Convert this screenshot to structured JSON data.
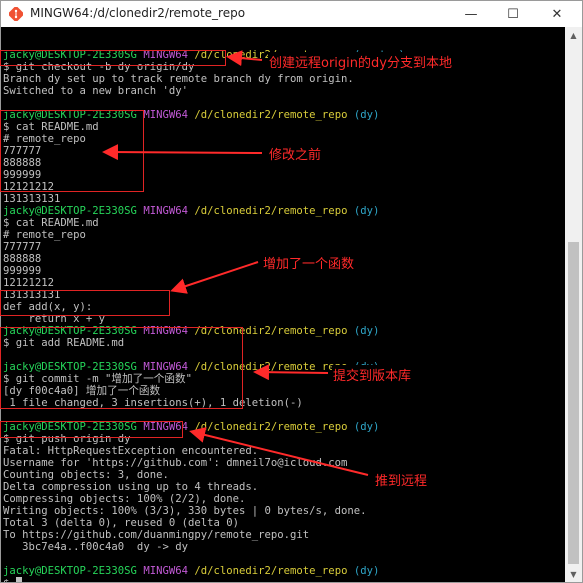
{
  "window": {
    "title": "MINGW64:/d/clonedir2/remote_repo",
    "minimize": "—",
    "maximize": "☐",
    "close": "✕"
  },
  "terminal": {
    "lines": [
      {
        "segments": []
      },
      {
        "segments": [
          {
            "t": "jacky@DESKTOP-2E330SG",
            "c": "user"
          },
          {
            "t": " "
          },
          {
            "t": "MINGW64",
            "c": "host"
          },
          {
            "t": " "
          },
          {
            "t": "/d/clonedir2/remote_repo",
            "c": "path"
          },
          {
            "t": " "
          },
          {
            "t": "(master)",
            "c": "branch"
          }
        ]
      },
      {
        "segments": [
          {
            "t": "$ git checkout -b dy origin/dy"
          }
        ]
      },
      {
        "segments": [
          {
            "t": "Branch dy set up to track remote branch dy from origin."
          }
        ]
      },
      {
        "segments": [
          {
            "t": "Switched to a new branch 'dy'"
          }
        ]
      },
      {
        "segments": []
      },
      {
        "segments": [
          {
            "t": "jacky@DESKTOP-2E330SG",
            "c": "user"
          },
          {
            "t": " "
          },
          {
            "t": "MINGW64",
            "c": "host"
          },
          {
            "t": " "
          },
          {
            "t": "/d/clonedir2/remote_repo",
            "c": "path"
          },
          {
            "t": " "
          },
          {
            "t": "(dy)",
            "c": "branch"
          }
        ]
      },
      {
        "segments": [
          {
            "t": "$ cat README.md"
          }
        ]
      },
      {
        "segments": [
          {
            "t": "# remote_repo"
          }
        ]
      },
      {
        "segments": [
          {
            "t": "777777"
          }
        ]
      },
      {
        "segments": [
          {
            "t": "888888"
          }
        ]
      },
      {
        "segments": [
          {
            "t": "999999"
          }
        ]
      },
      {
        "segments": [
          {
            "t": "12121212"
          }
        ]
      },
      {
        "segments": [
          {
            "t": "131313131"
          }
        ]
      },
      {
        "segments": [
          {
            "t": "jacky@DESKTOP-2E330SG",
            "c": "user"
          },
          {
            "t": " "
          },
          {
            "t": "MINGW64",
            "c": "host"
          },
          {
            "t": " "
          },
          {
            "t": "/d/clonedir2/remote_repo",
            "c": "path"
          },
          {
            "t": " "
          },
          {
            "t": "(dy)",
            "c": "branch"
          }
        ]
      },
      {
        "segments": [
          {
            "t": "$ cat README.md"
          }
        ]
      },
      {
        "segments": [
          {
            "t": "# remote_repo"
          }
        ]
      },
      {
        "segments": [
          {
            "t": "777777"
          }
        ]
      },
      {
        "segments": [
          {
            "t": "888888"
          }
        ]
      },
      {
        "segments": [
          {
            "t": "999999"
          }
        ]
      },
      {
        "segments": [
          {
            "t": "12121212"
          }
        ]
      },
      {
        "segments": [
          {
            "t": "131313131"
          }
        ]
      },
      {
        "segments": [
          {
            "t": "def add(x, y):"
          }
        ]
      },
      {
        "segments": [
          {
            "t": "    return x + y"
          }
        ]
      },
      {
        "segments": [
          {
            "t": "jacky@DESKTOP-2E330SG",
            "c": "user"
          },
          {
            "t": " "
          },
          {
            "t": "MINGW64",
            "c": "host"
          },
          {
            "t": " "
          },
          {
            "t": "/d/clonedir2/remote_repo",
            "c": "path"
          },
          {
            "t": " "
          },
          {
            "t": "(dy)",
            "c": "branch"
          }
        ]
      },
      {
        "segments": [
          {
            "t": "$ git add README.md"
          }
        ]
      },
      {
        "segments": []
      },
      {
        "segments": [
          {
            "t": "jacky@DESKTOP-2E330SG",
            "c": "user"
          },
          {
            "t": " "
          },
          {
            "t": "MINGW64",
            "c": "host"
          },
          {
            "t": " "
          },
          {
            "t": "/d/clonedir2/remote_repo",
            "c": "path"
          },
          {
            "t": " "
          },
          {
            "t": "(dy)",
            "c": "branch"
          }
        ]
      },
      {
        "segments": [
          {
            "t": "$ git commit -m \"增加了一个函数\""
          }
        ]
      },
      {
        "segments": [
          {
            "t": "[dy f00c4a0] 增加了一个函数"
          }
        ]
      },
      {
        "segments": [
          {
            "t": " 1 file changed, 3 insertions(+), 1 deletion(-)"
          }
        ]
      },
      {
        "segments": []
      },
      {
        "segments": [
          {
            "t": "jacky@DESKTOP-2E330SG",
            "c": "user"
          },
          {
            "t": " "
          },
          {
            "t": "MINGW64",
            "c": "host"
          },
          {
            "t": " "
          },
          {
            "t": "/d/clonedir2/remote_repo",
            "c": "path"
          },
          {
            "t": " "
          },
          {
            "t": "(dy)",
            "c": "branch"
          }
        ]
      },
      {
        "segments": [
          {
            "t": "$ git push origin dy"
          }
        ]
      },
      {
        "segments": [
          {
            "t": "Fatal: HttpRequestException encountered."
          }
        ]
      },
      {
        "segments": [
          {
            "t": "Username for 'https://github.com': dmneil7o@icloud.com"
          }
        ]
      },
      {
        "segments": [
          {
            "t": "Counting objects: 3, done."
          }
        ]
      },
      {
        "segments": [
          {
            "t": "Delta compression using up to 4 threads."
          }
        ]
      },
      {
        "segments": [
          {
            "t": "Compressing objects: 100% (2/2), done."
          }
        ]
      },
      {
        "segments": [
          {
            "t": "Writing objects: 100% (3/3), 330 bytes | 0 bytes/s, done."
          }
        ]
      },
      {
        "segments": [
          {
            "t": "Total 3 (delta 0), reused 0 (delta 0)"
          }
        ]
      },
      {
        "segments": [
          {
            "t": "To https://github.com/duanmingpy/remote_repo.git"
          }
        ]
      },
      {
        "segments": [
          {
            "t": "   3bc7e4a..f00c4a0  dy -> dy"
          }
        ]
      },
      {
        "segments": []
      },
      {
        "segments": [
          {
            "t": "jacky@DESKTOP-2E330SG",
            "c": "user"
          },
          {
            "t": " "
          },
          {
            "t": "MINGW64",
            "c": "host"
          },
          {
            "t": " "
          },
          {
            "t": "/d/clonedir2/remote_repo",
            "c": "path"
          },
          {
            "t": " "
          },
          {
            "t": "(dy)",
            "c": "branch"
          }
        ]
      },
      {
        "segments": [
          {
            "t": "$ "
          }
        ],
        "cursor": true
      }
    ]
  },
  "annotations": {
    "checkout_note": "创建远程origin的dy分支到本地",
    "before_note": "修改之前",
    "added_function_note": "增加了一个函数",
    "commit_note": "提交到版本库",
    "push_note": "推到远程"
  },
  "colors": {
    "annotation": "#ff2a2a",
    "user": "#26d65a",
    "host": "#c35ad7",
    "path": "#d8cc3a",
    "branch": "#2fa6c8",
    "text": "#c0c0c0"
  }
}
